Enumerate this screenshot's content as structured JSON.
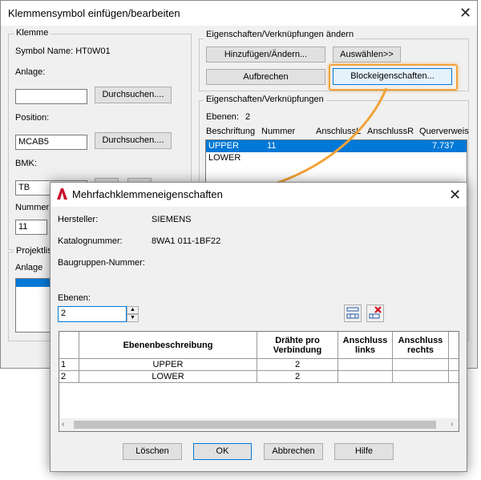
{
  "bg_dialog": {
    "title": "Klemmensymbol einfügen/bearbeiten",
    "klemme": {
      "group_label": "Klemme",
      "symbol_name": "Symbol Name: HT0W01",
      "anlage_label": "Anlage:",
      "anlage_value": "",
      "browse1": "Durchsuchen....",
      "position_label": "Position:",
      "position_value": "MCAB5",
      "browse2": "Durchsuchen....",
      "bmk_label": "BMK:",
      "bmk_value": "TB",
      "nummer_label": "Nummer",
      "nummer_value": "11"
    },
    "projekt": {
      "group_label": "Projektlis",
      "anlage_label": "Anlage"
    },
    "eig_aendern": {
      "group_label": "Eigenschaften/Verknüpfungen ändern",
      "add_change": "Hinzufügen/Ändern...",
      "select": "Auswählen>>",
      "break": "Aufbrechen",
      "block_props": "Blockeigenschaften..."
    },
    "eig": {
      "group_label": "Eigenschaften/Verknüpfungen",
      "ebenen_label": "Ebenen:",
      "ebenen_value": "2",
      "columns": [
        "Beschriftung",
        "Nummer",
        "AnschlussL",
        "AnschlussR",
        "Querverweis"
      ],
      "rows": [
        {
          "beschriftung": "UPPER",
          "nummer": "11",
          "querverweis": "7.737",
          "selected": true
        },
        {
          "beschriftung": "LOWER",
          "nummer": "",
          "querverweis": "",
          "selected": false
        }
      ]
    }
  },
  "fg_dialog": {
    "title": "Mehrfachklemmeneigenschaften",
    "hersteller_label": "Hersteller:",
    "hersteller_value": "SIEMENS",
    "katalog_label": "Katalognummer:",
    "katalog_value": "8WA1 011-1BF22",
    "baugruppe_label": "Baugruppen-Nummer:",
    "ebenen_label": "Ebenen:",
    "ebenen_value": "2",
    "table": {
      "headers": [
        "Ebenenbeschreibung",
        "Drähte pro Verbindung",
        "Anschluss links",
        "Anschluss rechts"
      ],
      "rows": [
        {
          "num": "1",
          "desc": "UPPER",
          "wires": "2"
        },
        {
          "num": "2",
          "desc": "LOWER",
          "wires": "2"
        }
      ]
    },
    "buttons": {
      "delete": "Löschen",
      "ok": "OK",
      "cancel": "Abbrechen",
      "help": "Hilfe"
    }
  },
  "colors": {
    "highlight_orange": "#f2a33a",
    "selection_blue": "#0078d7",
    "autocad_red": "#c8102e"
  }
}
